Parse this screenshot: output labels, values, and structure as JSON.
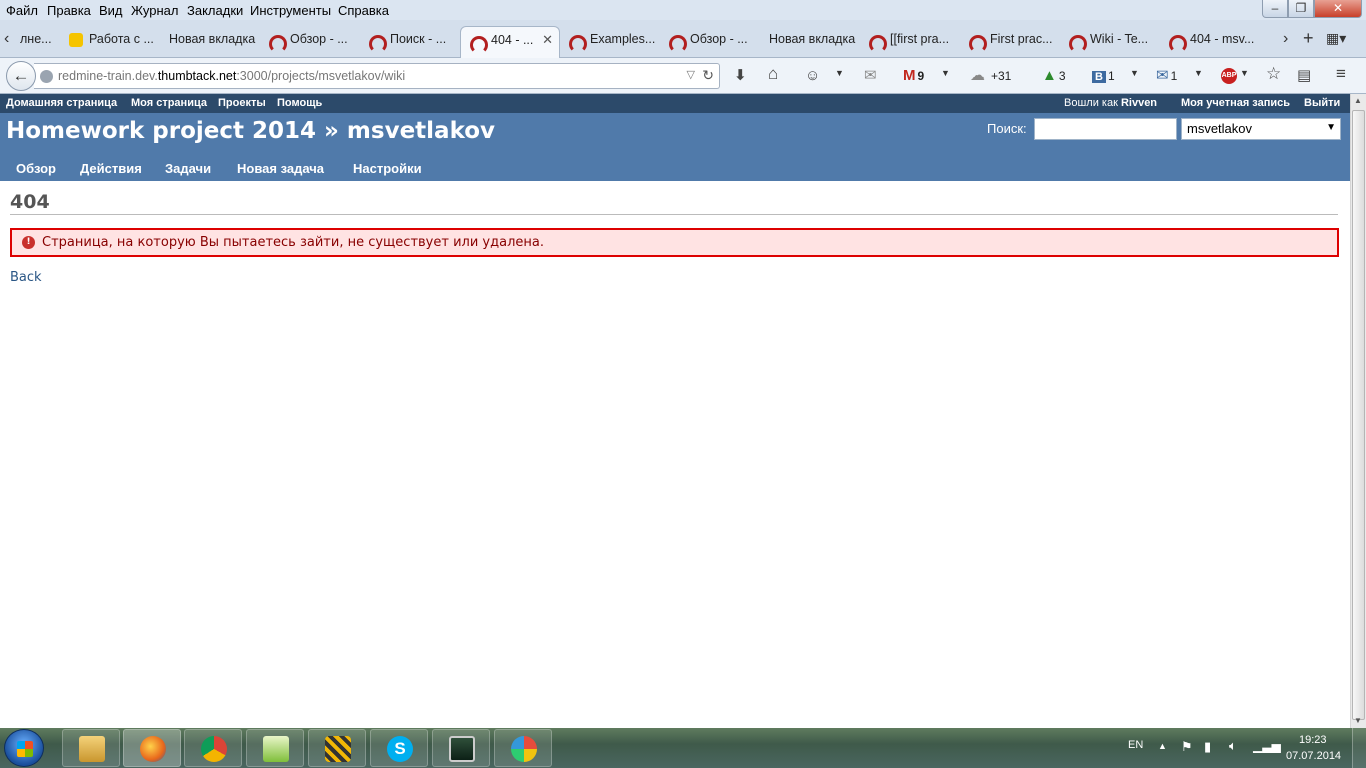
{
  "browser": {
    "menu": [
      "Файл",
      "Правка",
      "Вид",
      "Журнал",
      "Закладки",
      "Инструменты",
      "Справка"
    ],
    "tabs": [
      {
        "label": "лне...",
        "icon": "none"
      },
      {
        "label": "Работа с ...",
        "icon": "yandex-icon"
      },
      {
        "label": "Новая вкладка",
        "icon": "none"
      },
      {
        "label": "Обзор - ...",
        "icon": "redmine-icon"
      },
      {
        "label": "Поиск - ...",
        "icon": "redmine-icon"
      },
      {
        "label": "404 - ...",
        "icon": "redmine-icon",
        "active": true
      },
      {
        "label": "Examples...",
        "icon": "redmine-icon"
      },
      {
        "label": "Обзор - ...",
        "icon": "redmine-icon"
      },
      {
        "label": "Новая вкладка",
        "icon": "none"
      },
      {
        "label": "[[first pra...",
        "icon": "redmine-icon"
      },
      {
        "label": "First prac...",
        "icon": "redmine-icon"
      },
      {
        "label": "Wiki - Te...",
        "icon": "redmine-icon"
      },
      {
        "label": "404 - msv...",
        "icon": "redmine-icon"
      }
    ],
    "url_prefix": "redmine-train.dev.",
    "url_host": "thumbtack.net",
    "url_suffix": ":3000/projects/msvetlakov/wiki",
    "toolbar": {
      "gmail_count": "9",
      "weather": "+31",
      "green_count": "3",
      "vk_count": "1",
      "mail_count": "1"
    }
  },
  "redmine": {
    "top_menu": [
      "Домашняя страница",
      "Моя страница",
      "Проекты",
      "Помощь"
    ],
    "logged_as": "Вошли как",
    "user": "Rivven",
    "my_account": "Моя учетная запись",
    "logout": "Выйти",
    "project_title": "Homework project 2014 » msvetlakov",
    "search_label": "Поиск:",
    "search_value": "",
    "project_select": "msvetlakov",
    "main_menu": [
      "Обзор",
      "Действия",
      "Задачи",
      "Новая задача",
      "Настройки"
    ],
    "page_title": "404",
    "error_message": "Страница, на которую Вы пытаетесь зайти, не существует или удалена.",
    "back_link": "Back"
  },
  "taskbar": {
    "lang": "EN",
    "time": "19:23",
    "date": "07.07.2014"
  },
  "colors": {
    "header_bg": "#507aaa",
    "top_menu_bg": "#2c4a6a",
    "flash_bg": "#ffe3e3",
    "flash_border": "#dd0000"
  }
}
